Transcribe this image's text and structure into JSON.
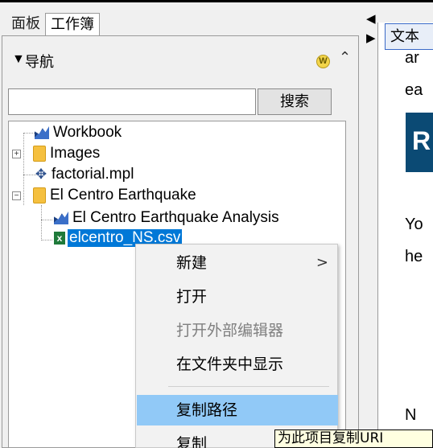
{
  "left_tabs": [
    {
      "label": "面板"
    },
    {
      "label": "工作簿"
    }
  ],
  "nav": {
    "title": "导航",
    "triangle": "▼",
    "w_icon": "W",
    "scroll_up": "⌃"
  },
  "search": {
    "value": "",
    "placeholder": "",
    "button_label": "搜索"
  },
  "tree": {
    "items": [
      {
        "label": "Workbook",
        "icon": "workbook-icon"
      },
      {
        "label": "Images",
        "icon": "folder-icon",
        "expander": "+"
      },
      {
        "label": "factorial.mpl",
        "icon": "plot-icon"
      },
      {
        "label": "El Centro Earthquake",
        "icon": "folder-icon",
        "expander": "−"
      },
      {
        "label": "El Centro Earthquake Analysis",
        "icon": "workbook-icon"
      },
      {
        "label": "elcentro_NS.csv",
        "icon": "csv-icon",
        "selected": true
      }
    ]
  },
  "context_menu": {
    "items": [
      {
        "label": "新建",
        "submenu": ">"
      },
      {
        "label": "打开"
      },
      {
        "label": "打开外部编辑器",
        "disabled": true
      },
      {
        "label": "在文件夹中显示"
      },
      {
        "label": "复制路径",
        "highlighted": true
      },
      {
        "label": "复制"
      }
    ]
  },
  "tooltip": "为此项目复制URI",
  "right_panel": {
    "tab_label": "文本",
    "lines": [
      "ar",
      "ea",
      "Yo",
      "he",
      "N"
    ],
    "heading_letter": "R"
  },
  "colors": {
    "selection": "#0078d7",
    "menu_highlight": "#91c9f7",
    "heading_block": "#0b4a74"
  }
}
